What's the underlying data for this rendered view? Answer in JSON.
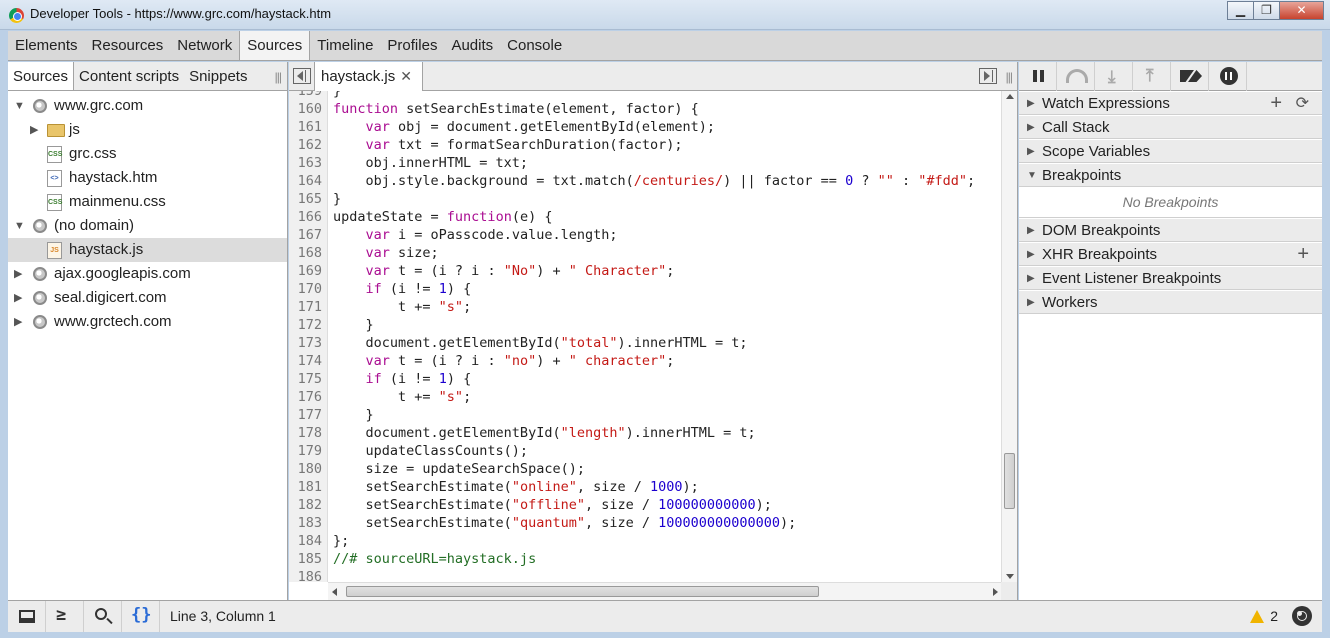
{
  "window": {
    "title": "Developer Tools - https://www.grc.com/haystack.htm",
    "minimize": "▁",
    "restore": "❐",
    "close": "✕"
  },
  "panel_tabs": [
    "Elements",
    "Resources",
    "Network",
    "Sources",
    "Timeline",
    "Profiles",
    "Audits",
    "Console"
  ],
  "active_panel": "Sources",
  "navigator": {
    "tabs": [
      "Sources",
      "Content scripts",
      "Snippets"
    ],
    "grip": "|||",
    "tree": [
      {
        "label": "www.grc.com",
        "type": "domain",
        "expanded": true,
        "indent": 0
      },
      {
        "label": "js",
        "type": "folder",
        "expanded": false,
        "indent": 1
      },
      {
        "label": "grc.css",
        "type": "css",
        "indent": 1
      },
      {
        "label": "haystack.htm",
        "type": "htm",
        "indent": 1
      },
      {
        "label": "mainmenu.css",
        "type": "css",
        "indent": 1
      },
      {
        "label": "(no domain)",
        "type": "domain",
        "expanded": true,
        "indent": 0
      },
      {
        "label": "haystack.js",
        "type": "js",
        "indent": 1,
        "selected": true
      },
      {
        "label": "ajax.googleapis.com",
        "type": "domain",
        "expanded": false,
        "indent": 0
      },
      {
        "label": "seal.digicert.com",
        "type": "domain",
        "expanded": false,
        "indent": 0
      },
      {
        "label": "www.grctech.com",
        "type": "domain",
        "expanded": false,
        "indent": 0
      }
    ]
  },
  "editor": {
    "tab_label": "haystack.js",
    "close_glyph": "✕",
    "grip": "|||",
    "lines": [
      {
        "n": "159",
        "html": "}"
      },
      {
        "n": "160",
        "html": "<span class=\"kw\">function</span> setSearchEstimate(element, factor) {"
      },
      {
        "n": "161",
        "html": "    <span class=\"kw\">var</span> obj = document.getElementById(element);"
      },
      {
        "n": "162",
        "html": "    <span class=\"kw\">var</span> txt = formatSearchDuration(factor);"
      },
      {
        "n": "163",
        "html": "    obj.innerHTML = txt;"
      },
      {
        "n": "164",
        "html": "    obj.style.background = txt.match(<span class=\"rx\">/centuries/</span>) || factor == <span class=\"num\">0</span> ? <span class=\"str\">\"\"</span> : <span class=\"str\">\"#fdd\"</span>;"
      },
      {
        "n": "165",
        "html": "}"
      },
      {
        "n": "166",
        "html": "updateState = <span class=\"kw\">function</span>(e) {"
      },
      {
        "n": "167",
        "html": "    <span class=\"kw\">var</span> i = oPasscode.value.length;"
      },
      {
        "n": "168",
        "html": "    <span class=\"kw\">var</span> size;"
      },
      {
        "n": "169",
        "html": "    <span class=\"kw\">var</span> t = (i ? i : <span class=\"str\">\"No\"</span>) + <span class=\"str\">\" Character\"</span>;"
      },
      {
        "n": "170",
        "html": "    <span class=\"kw\">if</span> (i != <span class=\"num\">1</span>) {"
      },
      {
        "n": "171",
        "html": "        t += <span class=\"str\">\"s\"</span>;"
      },
      {
        "n": "172",
        "html": "    }"
      },
      {
        "n": "173",
        "html": "    document.getElementById(<span class=\"str\">\"total\"</span>).innerHTML = t;"
      },
      {
        "n": "174",
        "html": "    <span class=\"kw\">var</span> t = (i ? i : <span class=\"str\">\"no\"</span>) + <span class=\"str\">\" character\"</span>;"
      },
      {
        "n": "175",
        "html": "    <span class=\"kw\">if</span> (i != <span class=\"num\">1</span>) {"
      },
      {
        "n": "176",
        "html": "        t += <span class=\"str\">\"s\"</span>;"
      },
      {
        "n": "177",
        "html": "    }"
      },
      {
        "n": "178",
        "html": "    document.getElementById(<span class=\"str\">\"length\"</span>).innerHTML = t;"
      },
      {
        "n": "179",
        "html": "    updateClassCounts();"
      },
      {
        "n": "180",
        "html": "    size = updateSearchSpace();"
      },
      {
        "n": "181",
        "html": "    setSearchEstimate(<span class=\"str\">\"online\"</span>, size / <span class=\"num\">1000</span>);"
      },
      {
        "n": "182",
        "html": "    setSearchEstimate(<span class=\"str\">\"offline\"</span>, size / <span class=\"num\">100000000000</span>);"
      },
      {
        "n": "183",
        "html": "    setSearchEstimate(<span class=\"str\">\"quantum\"</span>, size / <span class=\"num\">100000000000000</span>);"
      },
      {
        "n": "184",
        "html": "};"
      },
      {
        "n": "185",
        "html": "<span class=\"cmt\">//# sourceURL=haystack.js</span>"
      },
      {
        "n": "186",
        "html": ""
      }
    ]
  },
  "sidebar": {
    "panes": [
      {
        "id": "watch-expressions",
        "label": "Watch Expressions",
        "expanded": false
      },
      {
        "id": "call-stack",
        "label": "Call Stack",
        "expanded": false
      },
      {
        "id": "scope-variables",
        "label": "Scope Variables",
        "expanded": false
      },
      {
        "id": "breakpoints",
        "label": "Breakpoints",
        "expanded": true
      },
      {
        "id": "dom-breakpoints",
        "label": "DOM Breakpoints",
        "expanded": false
      },
      {
        "id": "xhr-breakpoints",
        "label": "XHR Breakpoints",
        "expanded": false
      },
      {
        "id": "event-listener-breakpoints",
        "label": "Event Listener Breakpoints",
        "expanded": false
      },
      {
        "id": "workers",
        "label": "Workers",
        "expanded": false
      }
    ],
    "breakpoints_empty": "No Breakpoints",
    "add_glyph": "+",
    "refresh_glyph": "⟳"
  },
  "statusbar": {
    "console_glyph": "≥",
    "pretty_print_glyph": "{}",
    "cursor_position": "Line 3, Column 1",
    "warning_count": "2"
  }
}
